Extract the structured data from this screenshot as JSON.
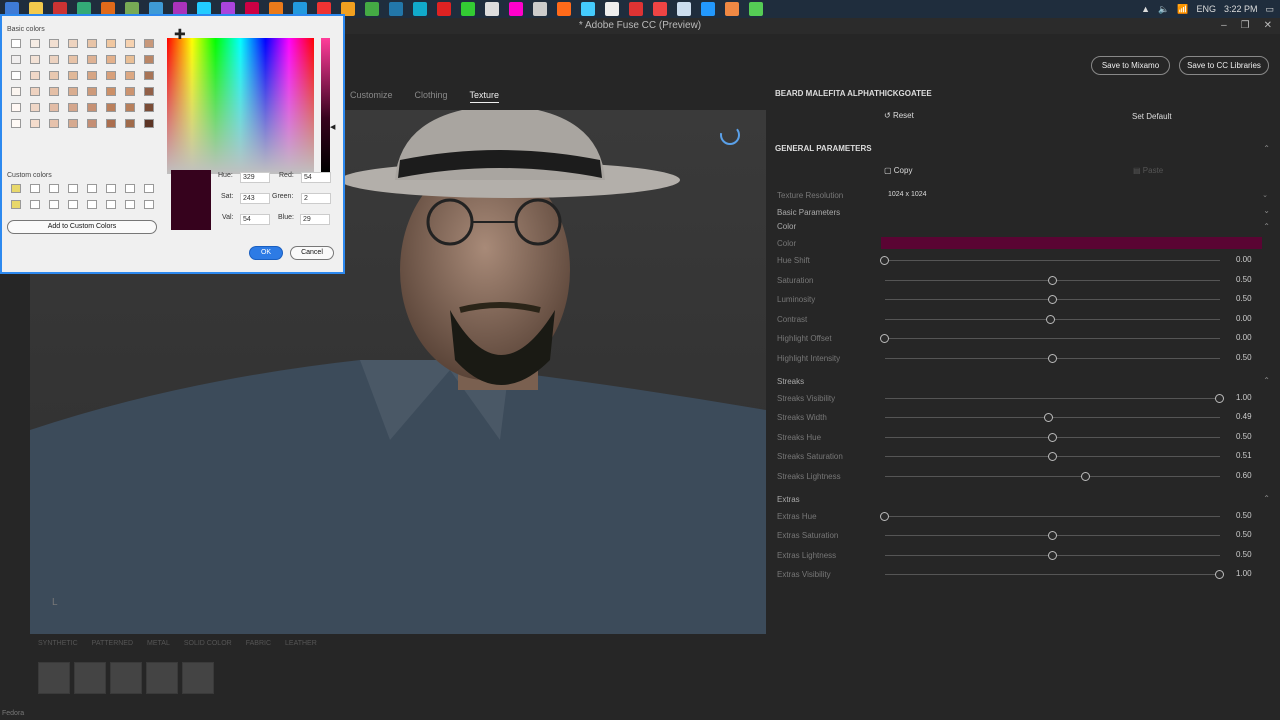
{
  "taskbar": {
    "tray": {
      "language": "ENG",
      "time": "3:22 PM"
    },
    "icon_colors": [
      "#3e7bd6",
      "#f2c94c",
      "#c33",
      "#3a7",
      "#e06a1a",
      "#7a5",
      "#3e9ad6",
      "#a3b",
      "#2cf",
      "#a4d",
      "#c04",
      "#ea7a1a",
      "#29d",
      "#e33",
      "#f0a020",
      "#4a4",
      "#27a",
      "#1ac",
      "#d22",
      "#3c3",
      "#ddd",
      "#f0c",
      "#ccc",
      "#ff6a1a",
      "#4cf",
      "#eee",
      "#d33",
      "#e44",
      "#cde",
      "#29f",
      "#e84",
      "#5c5"
    ]
  },
  "window": {
    "title": "* Adobe Fuse CC (Preview)"
  },
  "top_buttons": {
    "save_mixamo": "Save to Mixamo",
    "save_libraries": "Save to CC Libraries"
  },
  "tabs": {
    "customize": "Customize",
    "clothing": "Clothing",
    "texture": "Texture"
  },
  "panel": {
    "item_title": "BEARD MALEFITA ALPHATHICKGOATEE",
    "reset": "Reset",
    "set_default": "Set Default",
    "general_title": "GENERAL PARAMETERS",
    "copy": "Copy",
    "paste": "Paste",
    "texture_resolution_label": "Texture Resolution",
    "texture_resolution_value": "1024 x 1024",
    "basic_parameters": "Basic Parameters",
    "color_header": "Color",
    "color_label": "Color",
    "color_value": "#5a0433",
    "sliders": [
      {
        "label": "Hue Shift",
        "value": "0.00",
        "fraction": 0.0
      },
      {
        "label": "Saturation",
        "value": "0.50",
        "fraction": 0.5
      },
      {
        "label": "Luminosity",
        "value": "0.50",
        "fraction": 0.5
      },
      {
        "label": "Contrast",
        "value": "0.00",
        "fraction": 0.495
      },
      {
        "label": "Highlight Offset",
        "value": "0.00",
        "fraction": 0.0
      },
      {
        "label": "Highlight Intensity",
        "value": "0.50",
        "fraction": 0.5
      }
    ],
    "streaks_header": "Streaks",
    "streaks": [
      {
        "label": "Streaks Visibility",
        "value": "1.00",
        "fraction": 1.0
      },
      {
        "label": "Streaks Width",
        "value": "0.49",
        "fraction": 0.49
      },
      {
        "label": "Streaks Hue",
        "value": "0.50",
        "fraction": 0.5
      },
      {
        "label": "Streaks Saturation",
        "value": "0.51",
        "fraction": 0.5
      },
      {
        "label": "Streaks Lightness",
        "value": "0.60",
        "fraction": 0.6
      }
    ],
    "extras_header": "Extras",
    "extras": [
      {
        "label": "Extras Hue",
        "value": "0.50",
        "fraction": 0.0
      },
      {
        "label": "Extras Saturation",
        "value": "0.50",
        "fraction": 0.5
      },
      {
        "label": "Extras Lightness",
        "value": "0.50",
        "fraction": 0.5
      },
      {
        "label": "Extras Visibility",
        "value": "1.00",
        "fraction": 1.0
      }
    ]
  },
  "material_tabs": [
    "SYNTHETIC",
    "PATTERNED",
    "METAL",
    "SOLID COLOR",
    "FABRIC",
    "LEATHER"
  ],
  "status": {
    "text": "Fedora"
  },
  "color_dialog": {
    "basic_colors_label": "Basic colors",
    "custom_colors_label": "Custom colors",
    "add_button": "Add to Custom Colors",
    "hue_label": "Hue:",
    "hue": "329",
    "sat_label": "Sat:",
    "sat": "243",
    "val_label": "Val:",
    "val": "54",
    "red_label": "Red:",
    "red": "54",
    "green_label": "Green:",
    "green": "2",
    "blue_label": "Blue:",
    "blue": "29",
    "preview_color": "#36021d",
    "ok": "OK",
    "cancel": "Cancel",
    "basic_palette": [
      "#ffffff",
      "#f6ece4",
      "#f2dfd1",
      "#edd3bf",
      "#e8c4a7",
      "#f0c7a0",
      "#f6d2b0",
      "#c8987a",
      "#f0eeee",
      "#f3e2d6",
      "#ecd2c0",
      "#e7c3a8",
      "#deb294",
      "#e3b18c",
      "#e9bf96",
      "#ba8666",
      "#ffffff",
      "#f0d8c8",
      "#e8c8b0",
      "#e0b898",
      "#d6a584",
      "#d8a07a",
      "#dca882",
      "#a87456",
      "#fbf5f0",
      "#eed2c0",
      "#e4bfa6",
      "#d9ad90",
      "#cd9a7a",
      "#cc9068",
      "#cc9470",
      "#926048",
      "#fff8f4",
      "#efd6c6",
      "#e2bca6",
      "#d4a68c",
      "#c69174",
      "#bb805c",
      "#b8805c",
      "#7a4c36",
      "#fffaf6",
      "#f4dccc",
      "#e6c2ac",
      "#d6aa90",
      "#c48e74",
      "#ab6e4e",
      "#a06a4a",
      "#5c3424"
    ],
    "custom_palette": [
      "#e8d86a",
      "#ffffff",
      "#ffffff",
      "#ffffff",
      "#ffffff",
      "#ffffff",
      "#ffffff",
      "#ffffff",
      "#e8d86a",
      "#ffffff",
      "#ffffff",
      "#ffffff",
      "#ffffff",
      "#ffffff",
      "#ffffff",
      "#ffffff"
    ]
  }
}
